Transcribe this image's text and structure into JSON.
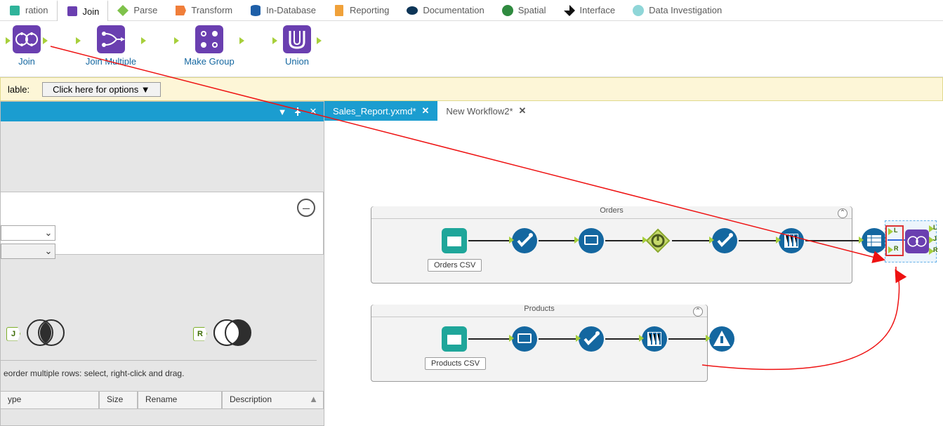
{
  "ribbon": {
    "tabs": [
      {
        "label": "ration",
        "icon": "prep",
        "color": "#2fb39a"
      },
      {
        "label": "Join",
        "icon": "join",
        "color": "#6a3fb0",
        "active": true
      },
      {
        "label": "Parse",
        "icon": "parse",
        "color": "#7fc24b"
      },
      {
        "label": "Transform",
        "icon": "transform",
        "color": "#f07e3a"
      },
      {
        "label": "In-Database",
        "icon": "indb",
        "color": "#1e5fa8"
      },
      {
        "label": "Reporting",
        "icon": "report",
        "color": "#f0a13a"
      },
      {
        "label": "Documentation",
        "icon": "doc",
        "color": "#0d3557"
      },
      {
        "label": "Spatial",
        "icon": "spatial",
        "color": "#2f8a3f"
      },
      {
        "label": "Interface",
        "icon": "iface",
        "color": "#111"
      },
      {
        "label": "Data Investigation",
        "icon": "datainv",
        "color": "#6fc7c9"
      }
    ]
  },
  "palette": {
    "tools": [
      {
        "label": "Join"
      },
      {
        "label": "Join Multiple"
      },
      {
        "label": "Make Group"
      },
      {
        "label": "Union"
      }
    ]
  },
  "notif": {
    "prefix_label": "lable:",
    "button_label": "Click here for options ▼"
  },
  "config_pane": {
    "dropdown_icon": "▼",
    "pin_icon": "📌",
    "close_icon": "✕",
    "minus_icon": "–",
    "venn_left_badge": "J",
    "venn_right_badge": "R",
    "reorder_hint": "eorder multiple rows: select, right-click and drag.",
    "headers": [
      "ype",
      "Size",
      "Rename",
      "Description"
    ],
    "scroll_indicator": "▲"
  },
  "work_tabs": [
    {
      "label": "Sales_Report.yxmd*",
      "active": true
    },
    {
      "label": "New Workflow2*",
      "active": false
    }
  ],
  "canvas": {
    "containers": [
      {
        "title": "Orders",
        "label": "Orders CSV"
      },
      {
        "title": "Products",
        "label": "Products CSV"
      }
    ]
  }
}
